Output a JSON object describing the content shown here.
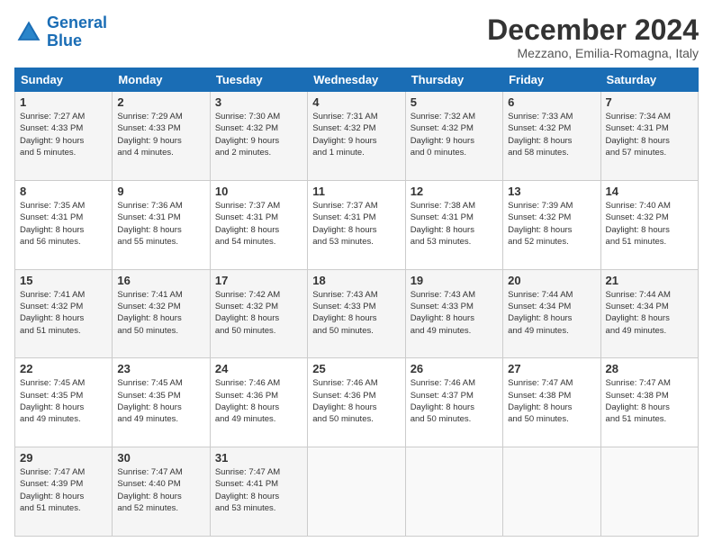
{
  "logo": {
    "line1": "General",
    "line2": "Blue"
  },
  "title": "December 2024",
  "subtitle": "Mezzano, Emilia-Romagna, Italy",
  "headers": [
    "Sunday",
    "Monday",
    "Tuesday",
    "Wednesday",
    "Thursday",
    "Friday",
    "Saturday"
  ],
  "weeks": [
    [
      {
        "day": "1",
        "info": "Sunrise: 7:27 AM\nSunset: 4:33 PM\nDaylight: 9 hours\nand 5 minutes."
      },
      {
        "day": "2",
        "info": "Sunrise: 7:29 AM\nSunset: 4:33 PM\nDaylight: 9 hours\nand 4 minutes."
      },
      {
        "day": "3",
        "info": "Sunrise: 7:30 AM\nSunset: 4:32 PM\nDaylight: 9 hours\nand 2 minutes."
      },
      {
        "day": "4",
        "info": "Sunrise: 7:31 AM\nSunset: 4:32 PM\nDaylight: 9 hours\nand 1 minute."
      },
      {
        "day": "5",
        "info": "Sunrise: 7:32 AM\nSunset: 4:32 PM\nDaylight: 9 hours\nand 0 minutes."
      },
      {
        "day": "6",
        "info": "Sunrise: 7:33 AM\nSunset: 4:32 PM\nDaylight: 8 hours\nand 58 minutes."
      },
      {
        "day": "7",
        "info": "Sunrise: 7:34 AM\nSunset: 4:31 PM\nDaylight: 8 hours\nand 57 minutes."
      }
    ],
    [
      {
        "day": "8",
        "info": "Sunrise: 7:35 AM\nSunset: 4:31 PM\nDaylight: 8 hours\nand 56 minutes."
      },
      {
        "day": "9",
        "info": "Sunrise: 7:36 AM\nSunset: 4:31 PM\nDaylight: 8 hours\nand 55 minutes."
      },
      {
        "day": "10",
        "info": "Sunrise: 7:37 AM\nSunset: 4:31 PM\nDaylight: 8 hours\nand 54 minutes."
      },
      {
        "day": "11",
        "info": "Sunrise: 7:37 AM\nSunset: 4:31 PM\nDaylight: 8 hours\nand 53 minutes."
      },
      {
        "day": "12",
        "info": "Sunrise: 7:38 AM\nSunset: 4:31 PM\nDaylight: 8 hours\nand 53 minutes."
      },
      {
        "day": "13",
        "info": "Sunrise: 7:39 AM\nSunset: 4:32 PM\nDaylight: 8 hours\nand 52 minutes."
      },
      {
        "day": "14",
        "info": "Sunrise: 7:40 AM\nSunset: 4:32 PM\nDaylight: 8 hours\nand 51 minutes."
      }
    ],
    [
      {
        "day": "15",
        "info": "Sunrise: 7:41 AM\nSunset: 4:32 PM\nDaylight: 8 hours\nand 51 minutes."
      },
      {
        "day": "16",
        "info": "Sunrise: 7:41 AM\nSunset: 4:32 PM\nDaylight: 8 hours\nand 50 minutes."
      },
      {
        "day": "17",
        "info": "Sunrise: 7:42 AM\nSunset: 4:32 PM\nDaylight: 8 hours\nand 50 minutes."
      },
      {
        "day": "18",
        "info": "Sunrise: 7:43 AM\nSunset: 4:33 PM\nDaylight: 8 hours\nand 50 minutes."
      },
      {
        "day": "19",
        "info": "Sunrise: 7:43 AM\nSunset: 4:33 PM\nDaylight: 8 hours\nand 49 minutes."
      },
      {
        "day": "20",
        "info": "Sunrise: 7:44 AM\nSunset: 4:34 PM\nDaylight: 8 hours\nand 49 minutes."
      },
      {
        "day": "21",
        "info": "Sunrise: 7:44 AM\nSunset: 4:34 PM\nDaylight: 8 hours\nand 49 minutes."
      }
    ],
    [
      {
        "day": "22",
        "info": "Sunrise: 7:45 AM\nSunset: 4:35 PM\nDaylight: 8 hours\nand 49 minutes."
      },
      {
        "day": "23",
        "info": "Sunrise: 7:45 AM\nSunset: 4:35 PM\nDaylight: 8 hours\nand 49 minutes."
      },
      {
        "day": "24",
        "info": "Sunrise: 7:46 AM\nSunset: 4:36 PM\nDaylight: 8 hours\nand 49 minutes."
      },
      {
        "day": "25",
        "info": "Sunrise: 7:46 AM\nSunset: 4:36 PM\nDaylight: 8 hours\nand 50 minutes."
      },
      {
        "day": "26",
        "info": "Sunrise: 7:46 AM\nSunset: 4:37 PM\nDaylight: 8 hours\nand 50 minutes."
      },
      {
        "day": "27",
        "info": "Sunrise: 7:47 AM\nSunset: 4:38 PM\nDaylight: 8 hours\nand 50 minutes."
      },
      {
        "day": "28",
        "info": "Sunrise: 7:47 AM\nSunset: 4:38 PM\nDaylight: 8 hours\nand 51 minutes."
      }
    ],
    [
      {
        "day": "29",
        "info": "Sunrise: 7:47 AM\nSunset: 4:39 PM\nDaylight: 8 hours\nand 51 minutes."
      },
      {
        "day": "30",
        "info": "Sunrise: 7:47 AM\nSunset: 4:40 PM\nDaylight: 8 hours\nand 52 minutes."
      },
      {
        "day": "31",
        "info": "Sunrise: 7:47 AM\nSunset: 4:41 PM\nDaylight: 8 hours\nand 53 minutes."
      },
      {
        "day": "",
        "info": ""
      },
      {
        "day": "",
        "info": ""
      },
      {
        "day": "",
        "info": ""
      },
      {
        "day": "",
        "info": ""
      }
    ]
  ]
}
